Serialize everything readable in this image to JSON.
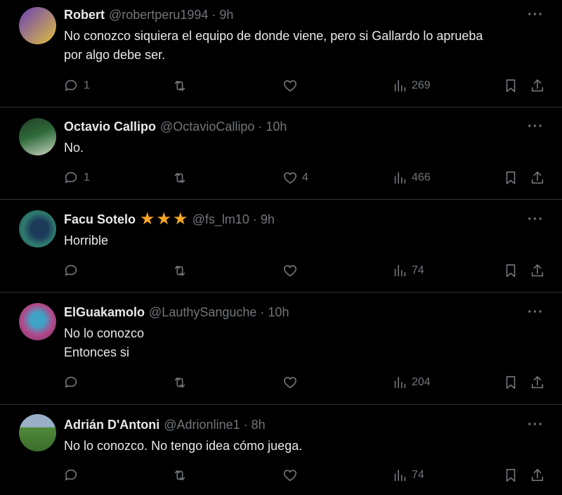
{
  "tweets": [
    {
      "name": "Robert",
      "handle": "@robertperu1994",
      "time": "9h",
      "text": [
        "No conozco siquiera el equipo de donde viene, pero si Gallardo lo aprueba",
        "por algo debe ser."
      ],
      "replies": "1",
      "likes": "",
      "views": "269",
      "avatar_colors": [
        "#6a3fb5",
        "#e0c040"
      ]
    },
    {
      "name": "Octavio Callipo",
      "handle": "@OctavioCallipo",
      "time": "10h",
      "text": [
        "No."
      ],
      "replies": "1",
      "likes": "4",
      "views": "466",
      "avatar_colors": [
        "#2f6a3a",
        "#c9d6c2"
      ]
    },
    {
      "name": "Facu Sotelo",
      "handle": "@fs_lm10",
      "time": "9h",
      "text": [
        "Horrible"
      ],
      "replies": "",
      "likes": "",
      "views": "74",
      "stars": 3,
      "avatar_colors": [
        "#2f7b6e",
        "#1c3a5a"
      ]
    },
    {
      "name": "ElGuakamolo",
      "handle": "@LauthySanguche",
      "time": "10h",
      "text": [
        "No lo conozco",
        "Entonces si"
      ],
      "replies": "",
      "likes": "",
      "views": "204",
      "avatar_colors": [
        "#b04a8a",
        "#3fa3c8"
      ]
    },
    {
      "name": "Adrián D'Antoni",
      "handle": "@Adrionline1",
      "time": "8h",
      "text": [
        "No lo conozco. No tengo idea cómo juega."
      ],
      "replies": "",
      "likes": "",
      "views": "74",
      "avatar_colors": [
        "#4f8a3a",
        "#9ab0c8"
      ]
    }
  ],
  "separator": "·",
  "more_label": "···"
}
